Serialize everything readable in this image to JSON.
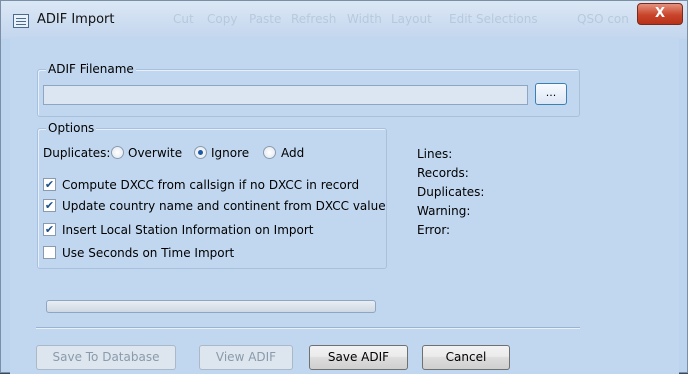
{
  "window": {
    "title": "ADIF Import",
    "close_glyph": "X"
  },
  "background_toolbar": [
    "Cut",
    "Copy",
    "Paste",
    "Refresh",
    "Width",
    "Layout",
    "Edit Selections",
    "QSO con"
  ],
  "filename": {
    "group_label": "ADIF Filename",
    "value": "",
    "browse_label": "..."
  },
  "options": {
    "group_label": "Options",
    "duplicates_label": "Duplicates:",
    "duplicates_options": [
      {
        "label": "Overwite",
        "selected": false
      },
      {
        "label": "Ignore",
        "selected": true
      },
      {
        "label": "Add",
        "selected": false
      }
    ],
    "checkboxes": [
      {
        "label": "Compute DXCC from callsign if no DXCC in record",
        "checked": true
      },
      {
        "label": "Update country name and continent from DXCC value",
        "checked": true
      },
      {
        "label": "Insert Local Station Information on Import",
        "checked": true
      },
      {
        "label": "Use Seconds on Time Import",
        "checked": false
      }
    ]
  },
  "stats": {
    "lines": "Lines:",
    "records": "Records:",
    "duplicates": "Duplicates:",
    "warning": "Warning:",
    "error": "Error:"
  },
  "progress": {
    "value": 0
  },
  "buttons": {
    "save_to_db": "Save To Database",
    "view_adif": "View ADIF",
    "save_adif": "Save ADIF",
    "cancel": "Cancel"
  }
}
